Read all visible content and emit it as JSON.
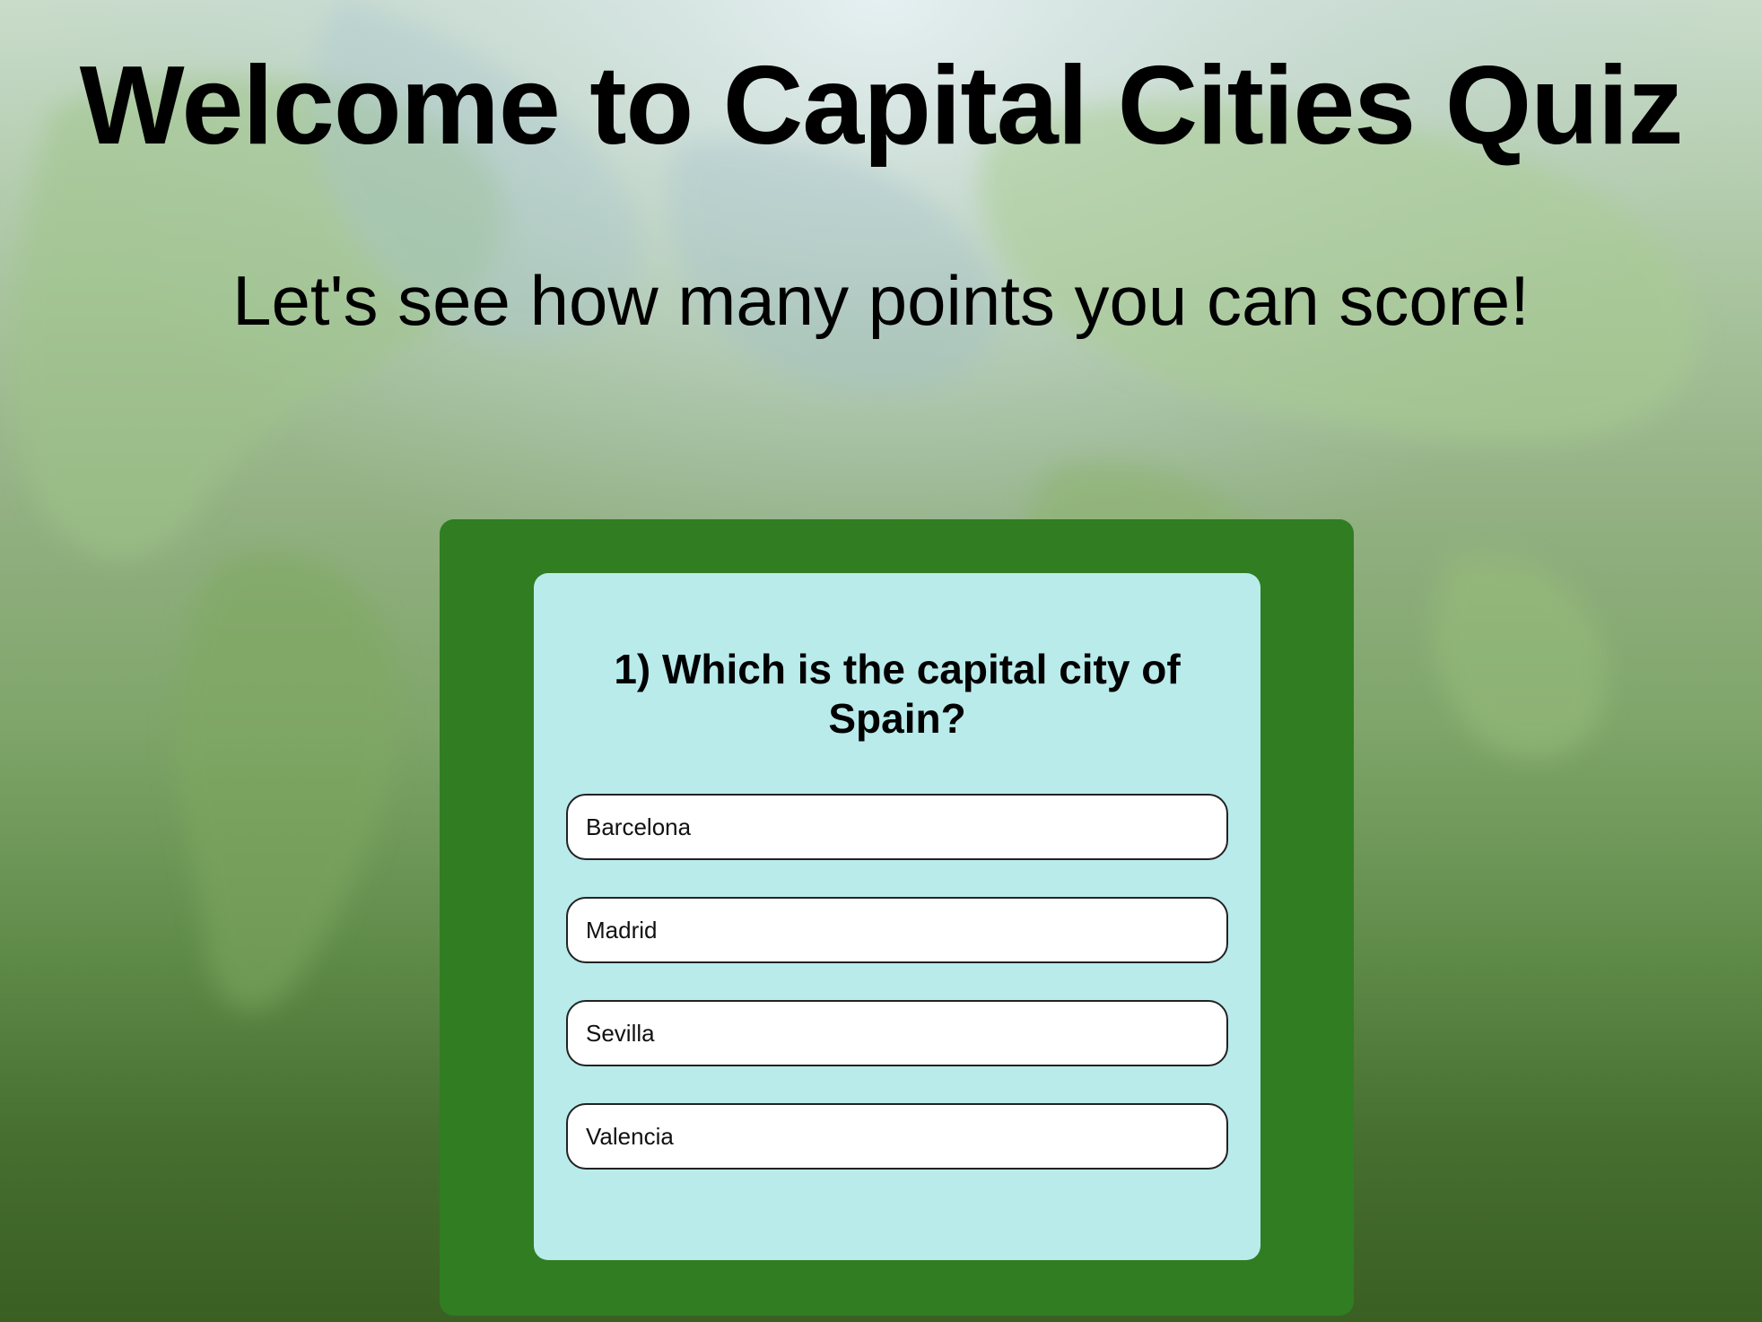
{
  "header": {
    "title": "Welcome to Capital Cities Quiz",
    "subtitle": "Let's see how many points you can score!"
  },
  "quiz": {
    "question": "1) Which is the capital city of Spain?",
    "answers": [
      {
        "label": "Barcelona"
      },
      {
        "label": "Madrid"
      },
      {
        "label": "Sevilla"
      },
      {
        "label": "Valencia"
      }
    ]
  },
  "colors": {
    "quiz_frame": "#317d22",
    "quiz_card": "#b9ebeb",
    "answer_background": "#ffffff"
  }
}
